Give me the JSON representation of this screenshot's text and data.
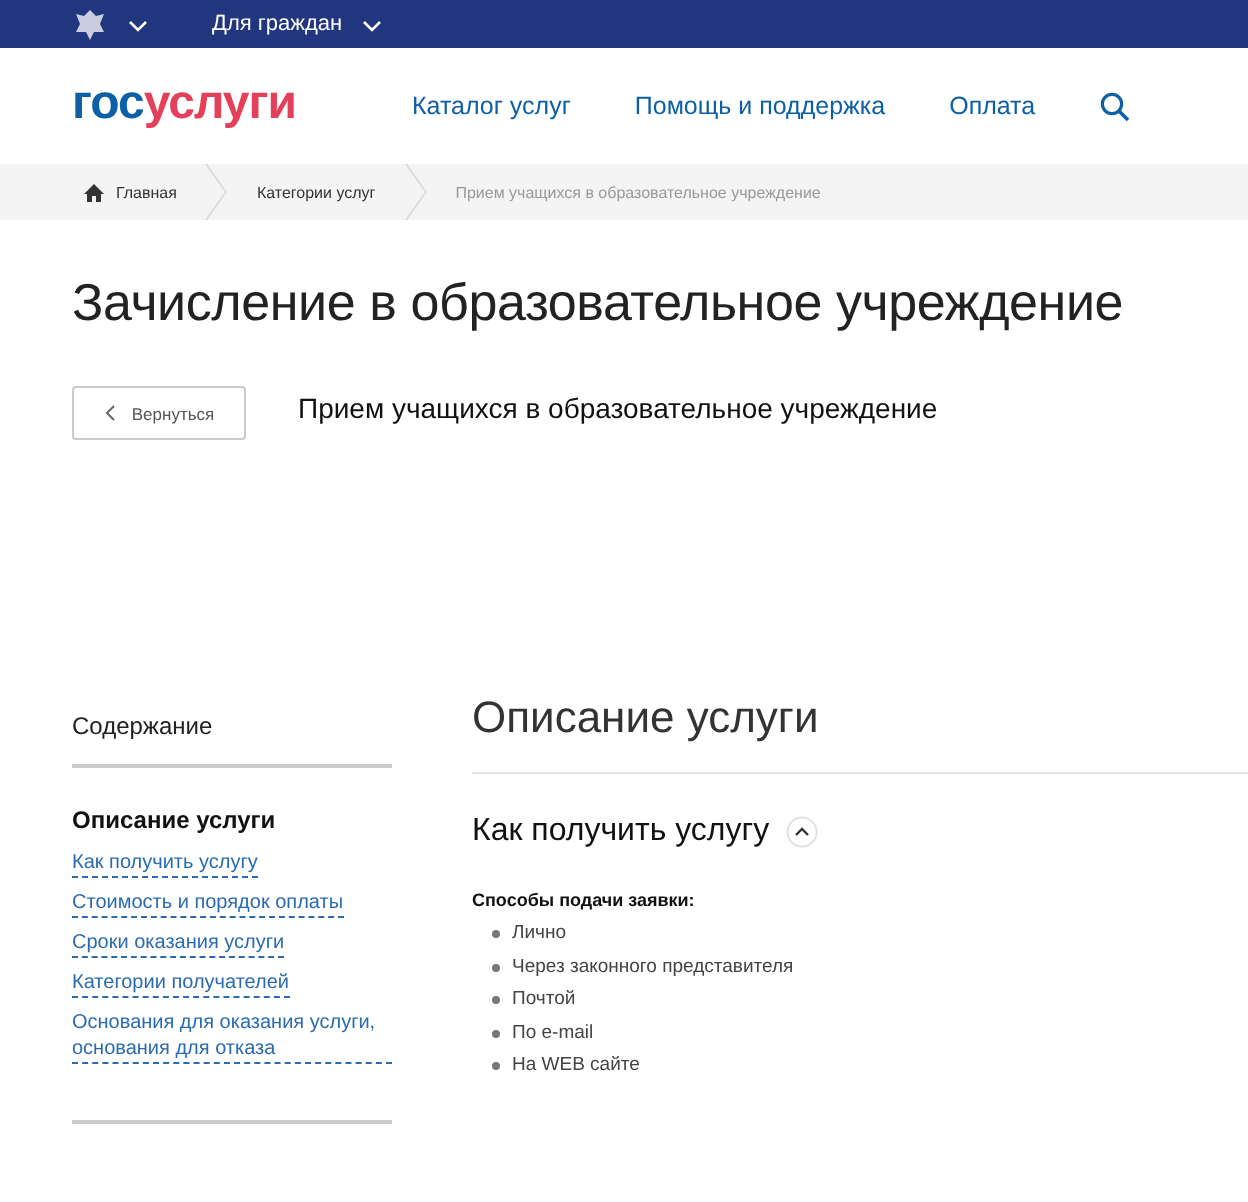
{
  "top_bar": {
    "menu_label": "Для граждан"
  },
  "header": {
    "logo": [
      {
        "text": "гос",
        "color": "#0d5fa6"
      },
      {
        "text": "услуги",
        "color": "#e4405a"
      }
    ],
    "nav": [
      "Каталог услуг",
      "Помощь и поддержка",
      "Оплата"
    ]
  },
  "breadcrumbs": [
    "Главная",
    "Категории услуг",
    "Прием учащихся в образовательное учреждение"
  ],
  "page_title": "Зачисление в образовательное учреждение",
  "back_button": "Вернуться",
  "service_name": "Прием учащихся в образовательное учреждение",
  "sidebar": {
    "title": "Содержание",
    "items": [
      {
        "label": "Описание услуги",
        "selected": true
      },
      {
        "label": "Как получить услугу",
        "selected": false
      },
      {
        "label": "Стоимость и порядок оплаты",
        "selected": false
      },
      {
        "label": "Сроки оказания услуги",
        "selected": false
      },
      {
        "label": "Категории получателей",
        "selected": false
      },
      {
        "label": "Основания для оказания услуги, основания для отказа",
        "selected": false
      }
    ]
  },
  "main": {
    "heading": "Описание услуги",
    "section": {
      "title": "Как получить услугу",
      "expanded": true,
      "subheading": "Способы подачи заявки:",
      "items": [
        "Лично",
        "Через законного представителя",
        "Почтой",
        "По e-mail",
        "На WEB сайте"
      ]
    }
  }
}
